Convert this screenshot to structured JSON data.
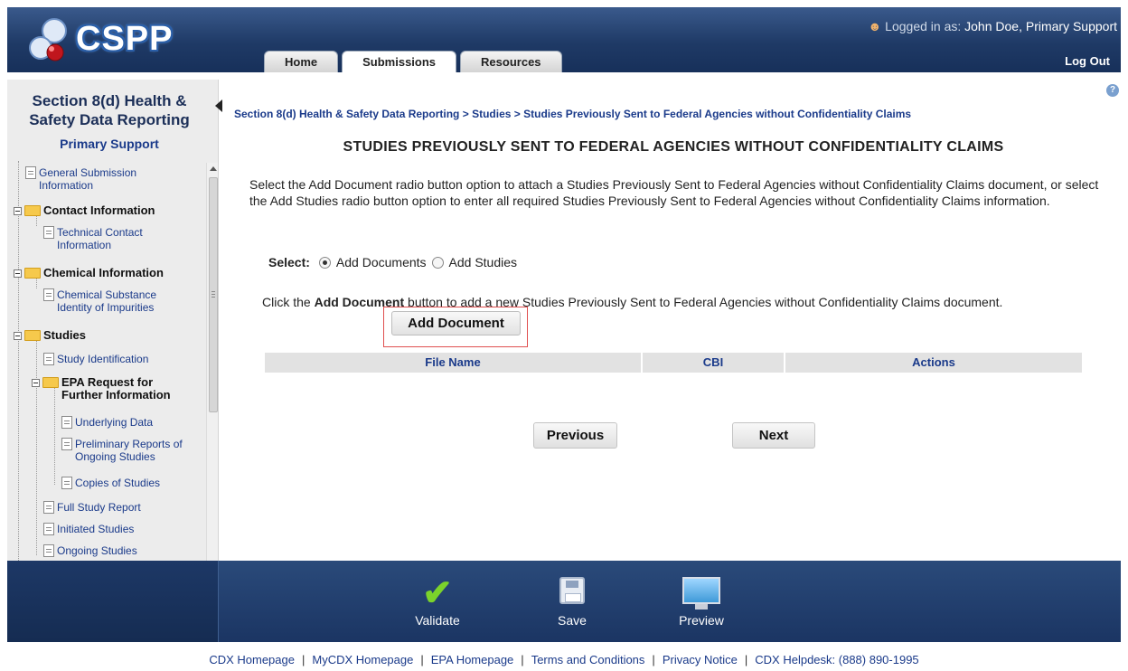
{
  "header": {
    "logo_text": "CSPP",
    "logged_in_label": "Logged in as:",
    "user": "John Doe, Primary Support",
    "logout": "Log Out",
    "tabs": [
      {
        "label": "Home",
        "active": false
      },
      {
        "label": "Submissions",
        "active": true
      },
      {
        "label": "Resources",
        "active": false
      }
    ]
  },
  "sidebar": {
    "title_line1": "Section 8(d) Health &",
    "title_line2": "Safety Data Reporting",
    "role": "Primary Support",
    "tree": [
      {
        "label_1": "General Submission",
        "label_2": "Information"
      },
      {
        "label": "Contact Information"
      },
      {
        "label_1": "Technical Contact",
        "label_2": "Information"
      },
      {
        "label": "Chemical Information"
      },
      {
        "label_1": "Chemical Substance",
        "label_2": "Identity of Impurities"
      },
      {
        "label": "Studies"
      },
      {
        "label": "Study Identification"
      },
      {
        "label_1": "EPA Request for",
        "label_2": "Further Information"
      },
      {
        "label": "Underlying Data"
      },
      {
        "label_1": "Preliminary Reports of",
        "label_2": "Ongoing Studies"
      },
      {
        "label": "Copies of Studies"
      },
      {
        "label": "Full Study Report"
      },
      {
        "label": "Initiated Studies"
      },
      {
        "label": "Ongoing Studies"
      }
    ]
  },
  "main": {
    "breadcrumb": {
      "item1": "Section 8(d) Health & Safety Data Reporting",
      "item2": "Studies",
      "item3": "Studies Previously Sent to Federal Agencies without Confidentiality Claims",
      "sep": ">"
    },
    "title": "STUDIES PREVIOUSLY SENT TO FEDERAL AGENCIES WITHOUT CONFIDENTIALITY CLAIMS",
    "instructions": "Select the Add Document radio button option to attach a Studies Previously Sent to Federal Agencies without Confidentiality Claims document, or select the Add Studies radio button option to enter all required Studies Previously Sent to Federal Agencies without Confidentiality Claims information.",
    "select_label": "Select:",
    "radio_options": [
      {
        "label": "Add Documents",
        "checked": true
      },
      {
        "label": "Add Studies",
        "checked": false
      }
    ],
    "add_text_before": "Click the ",
    "add_text_bold": "Add Document",
    "add_text_after": " button to add a new Studies Previously Sent to Federal Agencies without Confidentiality Claims document.",
    "add_document_button": "Add Document",
    "table_headers": [
      "File Name",
      "CBI",
      "Actions"
    ],
    "previous_button": "Previous",
    "next_button": "Next",
    "help_icon": "?"
  },
  "toolbar": {
    "validate": "Validate",
    "save": "Save",
    "preview": "Preview"
  },
  "footer": {
    "links": [
      "CDX Homepage",
      "MyCDX Homepage",
      "EPA Homepage",
      "Terms and Conditions",
      "Privacy Notice",
      "CDX Helpdesk: (888) 890-1995"
    ],
    "sep": "|"
  },
  "colors": {
    "header_blue": "#1f3a66",
    "link_blue": "#1a3a8a",
    "sidebar_bg": "#ececec",
    "highlight_red": "#e05050",
    "check_green": "#7bd32b"
  }
}
